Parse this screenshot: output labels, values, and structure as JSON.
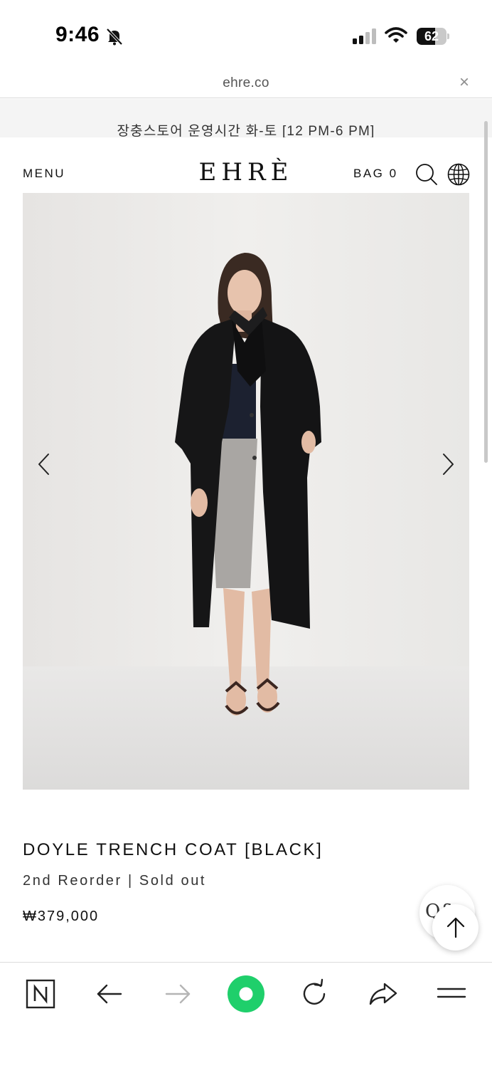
{
  "status_bar": {
    "time": "9:46",
    "battery_percent": "62",
    "battery_level": 0.62
  },
  "browser": {
    "url": "ehre.co",
    "close_glyph": "×"
  },
  "announcement": {
    "text": "장충스토어 운영시간 화-토 [12 PM-6 PM]"
  },
  "header": {
    "menu_label": "MENU",
    "logo": "EHRÈ",
    "bag_label": "BAG 0"
  },
  "product": {
    "title": "DOYLE TRENCH COAT [BLACK]",
    "status": "2nd Reorder | Sold out",
    "price": "₩379,000"
  },
  "floating": {
    "qna_label": "Q&"
  },
  "icons": {
    "status": [
      "bell-slash-icon",
      "signal-icon",
      "wifi-icon"
    ],
    "header": [
      "search-icon",
      "globe-icon"
    ],
    "gallery": [
      "chevron-left-icon",
      "chevron-right-icon"
    ],
    "toolbar": [
      "naver-icon",
      "back-arrow-icon",
      "forward-arrow-icon",
      "green-dot-icon",
      "reload-icon",
      "share-icon",
      "hamburger-icon"
    ]
  },
  "colors": {
    "accent_green": "#1fcf6b",
    "announcement_bg": "#f4f4f4",
    "disabled_gray": "#b5b5b5"
  }
}
